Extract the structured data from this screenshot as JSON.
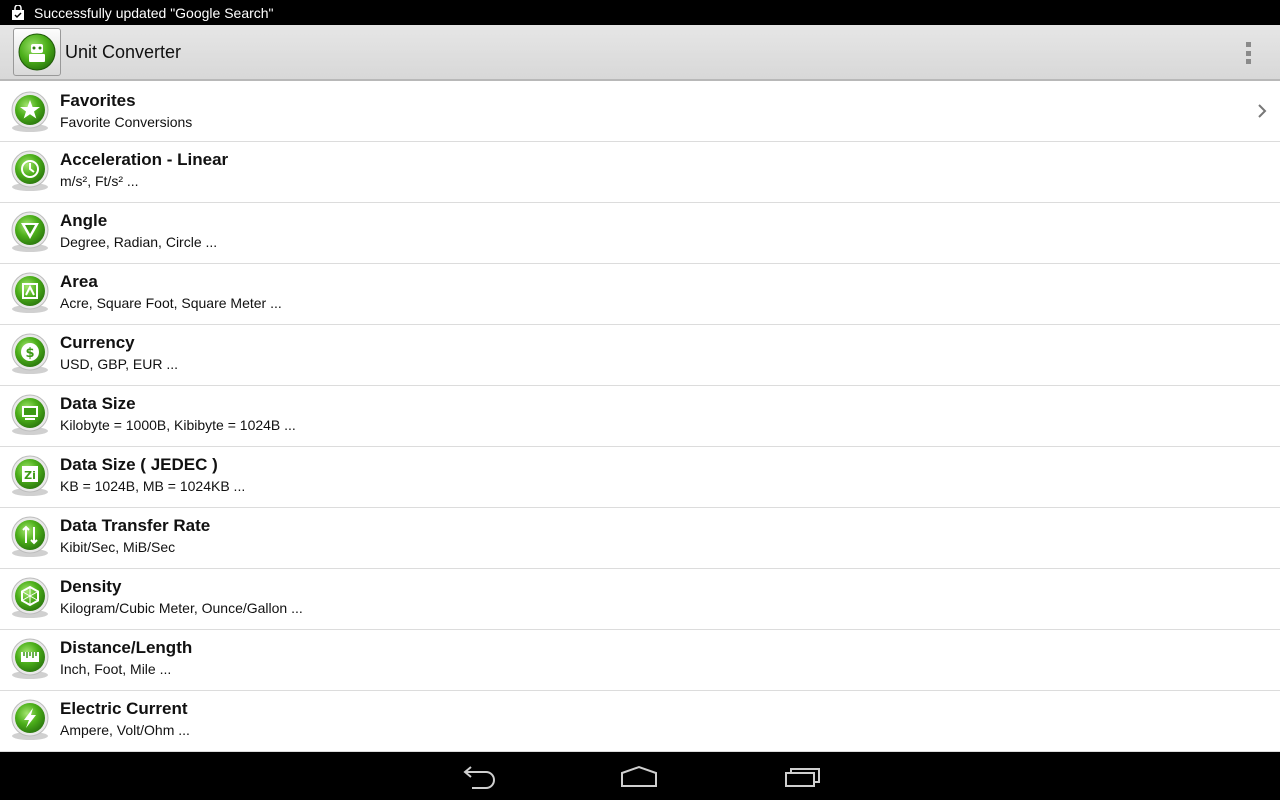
{
  "status_bar": {
    "notification_text": "Successfully updated \"Google Search\"",
    "notification_icon": "shopping-bag-icon"
  },
  "action_bar": {
    "title": "Unit Converter",
    "logo_icon": "robot-icon",
    "menu_icon": "overflow-menu-icon"
  },
  "categories": [
    {
      "title": "Favorites",
      "subtitle": "Favorite Conversions",
      "icon": "star-icon",
      "has_chevron": true
    },
    {
      "title": "Acceleration - Linear",
      "subtitle": "m/s², Ft/s² ...",
      "icon": "acceleration-icon"
    },
    {
      "title": "Angle",
      "subtitle": "Degree, Radian, Circle ...",
      "icon": "angle-icon"
    },
    {
      "title": "Area",
      "subtitle": "Acre, Square Foot, Square Meter ...",
      "icon": "area-icon"
    },
    {
      "title": "Currency",
      "subtitle": "USD, GBP, EUR ...",
      "icon": "currency-icon"
    },
    {
      "title": "Data Size",
      "subtitle": "Kilobyte = 1000B, Kibibyte = 1024B ...",
      "icon": "data-size-icon"
    },
    {
      "title": "Data Size ( JEDEC )",
      "subtitle": "KB = 1024B, MB = 1024KB ...",
      "icon": "data-size-jedec-icon"
    },
    {
      "title": "Data Transfer Rate",
      "subtitle": "Kibit/Sec, MiB/Sec",
      "icon": "data-transfer-icon"
    },
    {
      "title": "Density",
      "subtitle": "Kilogram/Cubic Meter, Ounce/Gallon ...",
      "icon": "density-icon"
    },
    {
      "title": "Distance/Length",
      "subtitle": "Inch, Foot, Mile ...",
      "icon": "ruler-icon"
    },
    {
      "title": "Electric Current",
      "subtitle": "Ampere, Volt/Ohm ...",
      "icon": "lightning-icon"
    }
  ],
  "nav_bar": {
    "back_icon": "back-icon",
    "home_icon": "home-icon",
    "recents_icon": "recent-apps-icon"
  },
  "colors": {
    "icon_green": "#4caf1a",
    "icon_green_dark": "#2e7d0f",
    "status_bar_bg": "#000000",
    "action_bar_bg": "#dedede"
  }
}
